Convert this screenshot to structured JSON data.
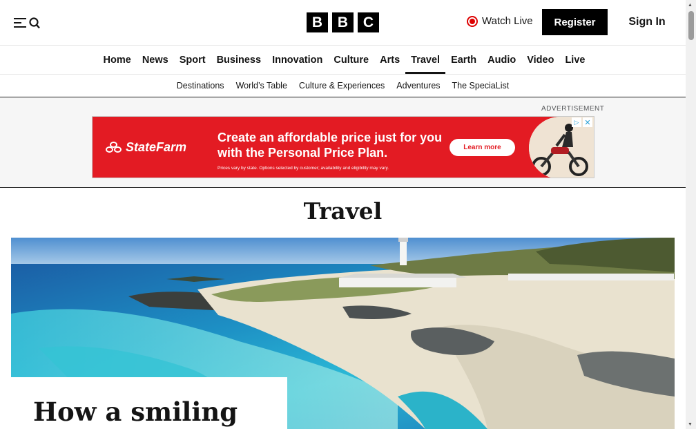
{
  "header": {
    "menu_icon": "menu-search-icon",
    "logo_letters": [
      "B",
      "B",
      "C"
    ],
    "watch_live_label": "Watch Live",
    "register_label": "Register",
    "signin_label": "Sign In"
  },
  "primary_nav": {
    "items": [
      "Home",
      "News",
      "Sport",
      "Business",
      "Innovation",
      "Culture",
      "Arts",
      "Travel",
      "Earth",
      "Audio",
      "Video",
      "Live"
    ],
    "active": "Travel"
  },
  "secondary_nav": {
    "items": [
      "Destinations",
      "World’s Table",
      "Culture & Experiences",
      "Adventures",
      "The SpeciaList"
    ]
  },
  "advertisement": {
    "label": "ADVERTISEMENT",
    "brand": "StateFarm",
    "headline": "Create an affordable price just for you with the Personal Price Plan.",
    "cta": "Learn more",
    "disclaimer": "Prices vary by state. Options selected by customer; availability and eligibility may vary.",
    "colors": {
      "brand_red": "#e31b23"
    }
  },
  "page": {
    "section_title": "Travel",
    "hero_headline": "How a smiling"
  }
}
